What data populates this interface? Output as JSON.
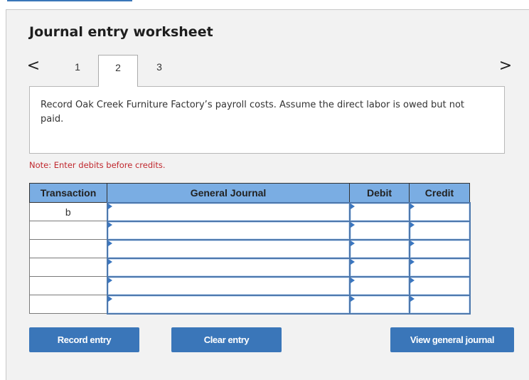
{
  "worksheet": {
    "title": "Journal entry worksheet",
    "nav_prev": "<",
    "nav_next": ">",
    "tabs": [
      {
        "label": "1",
        "active": false
      },
      {
        "label": "2",
        "active": true
      },
      {
        "label": "3",
        "active": false
      }
    ],
    "question": "Record Oak Creek Furniture Factory’s payroll costs. Assume the direct labor is owed but not paid.",
    "note": "Note: Enter debits before credits."
  },
  "table": {
    "headers": [
      "Transaction",
      "General Journal",
      "Debit",
      "Credit"
    ],
    "rows": [
      {
        "transaction": "b",
        "account": "",
        "debit": "",
        "credit": ""
      },
      {
        "transaction": "",
        "account": "",
        "debit": "",
        "credit": ""
      },
      {
        "transaction": "",
        "account": "",
        "debit": "",
        "credit": ""
      },
      {
        "transaction": "",
        "account": "",
        "debit": "",
        "credit": ""
      },
      {
        "transaction": "",
        "account": "",
        "debit": "",
        "credit": ""
      },
      {
        "transaction": "",
        "account": "",
        "debit": "",
        "credit": ""
      }
    ]
  },
  "buttons": {
    "record": "Record entry",
    "clear": "Clear entry",
    "view": "View general journal"
  },
  "colors": {
    "accent": "#3a76b9",
    "header_bg": "#7aade3",
    "note": "#c0272d"
  }
}
